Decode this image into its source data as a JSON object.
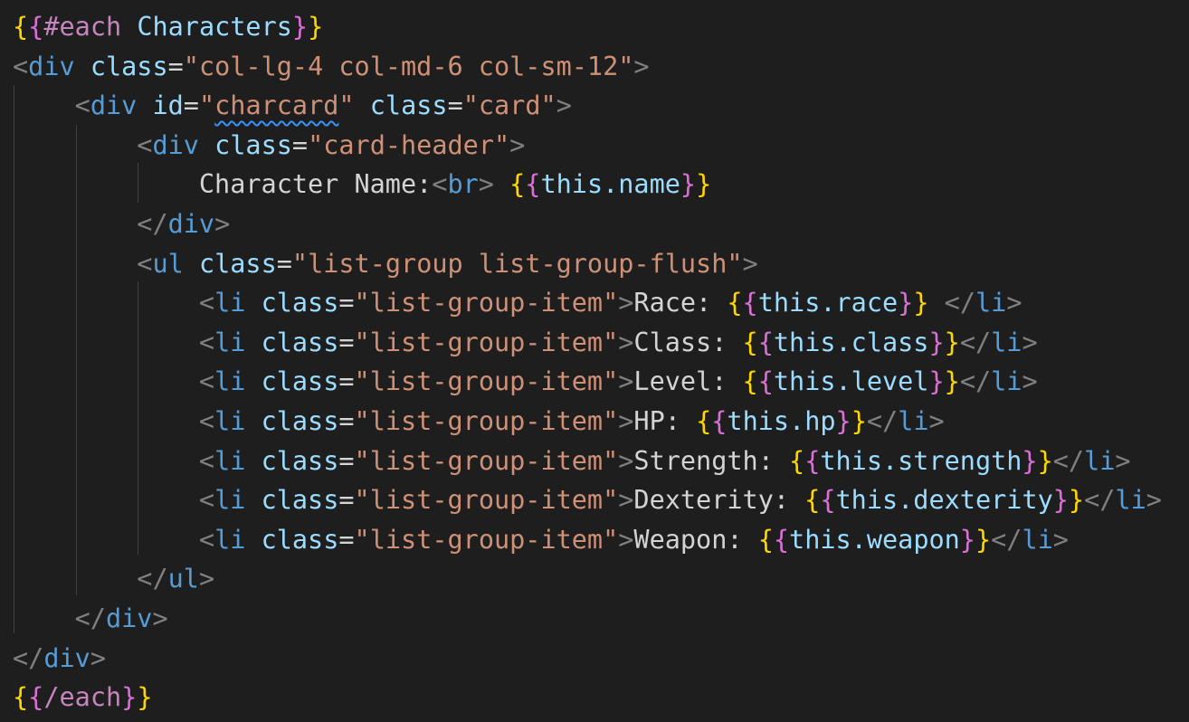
{
  "editor": {
    "language": "handlebars",
    "colors": {
      "background": "#1e1e1e",
      "tag": "#569cd6",
      "attribute": "#9cdcfe",
      "string": "#ce9178",
      "text": "#d4d4d4",
      "punctuation": "#808080",
      "brace_outer": "#ffd700",
      "brace_inner": "#da70d6",
      "helper_keyword": "#c586c0",
      "spell_check_underline": "#3794ff"
    },
    "lines": [
      {
        "tokens": [
          [
            "{",
            "tok-brace-yellow"
          ],
          [
            "{",
            "tok-brace-pink"
          ],
          [
            "#each",
            "tok-hbs-kw"
          ],
          [
            " ",
            "tok-text"
          ],
          [
            "Characters",
            "tok-hbs-var"
          ],
          [
            "}",
            "tok-brace-pink"
          ],
          [
            "}",
            "tok-brace-yellow"
          ]
        ]
      },
      {
        "tokens": [
          [
            "<",
            "tok-punct"
          ],
          [
            "div",
            "tok-tag"
          ],
          [
            " ",
            "tok-text"
          ],
          [
            "class",
            "tok-attr"
          ],
          [
            "=",
            "tok-eq"
          ],
          [
            "\"col-lg-4 col-md-6 col-sm-12\"",
            "tok-str"
          ],
          [
            ">",
            "tok-punct"
          ]
        ]
      },
      {
        "tokens": [
          [
            "    ",
            "tok-text"
          ],
          [
            "<",
            "tok-punct"
          ],
          [
            "div",
            "tok-tag"
          ],
          [
            " ",
            "tok-text"
          ],
          [
            "id",
            "tok-attr"
          ],
          [
            "=",
            "tok-eq"
          ],
          [
            "\"",
            "tok-str"
          ],
          [
            "charcard",
            "tok-str squiggle"
          ],
          [
            "\"",
            "tok-str"
          ],
          [
            " ",
            "tok-text"
          ],
          [
            "class",
            "tok-attr"
          ],
          [
            "=",
            "tok-eq"
          ],
          [
            "\"card\"",
            "tok-str"
          ],
          [
            ">",
            "tok-punct"
          ]
        ]
      },
      {
        "tokens": [
          [
            "        ",
            "tok-text"
          ],
          [
            "<",
            "tok-punct"
          ],
          [
            "div",
            "tok-tag"
          ],
          [
            " ",
            "tok-text"
          ],
          [
            "class",
            "tok-attr"
          ],
          [
            "=",
            "tok-eq"
          ],
          [
            "\"card-header\"",
            "tok-str"
          ],
          [
            ">",
            "tok-punct"
          ]
        ]
      },
      {
        "tokens": [
          [
            "            Character Name:",
            "tok-text"
          ],
          [
            "<",
            "tok-punct"
          ],
          [
            "br",
            "tok-tag"
          ],
          [
            ">",
            "tok-punct"
          ],
          [
            " ",
            "tok-text"
          ],
          [
            "{",
            "tok-brace-yellow"
          ],
          [
            "{",
            "tok-brace-pink"
          ],
          [
            "this.name",
            "tok-hbs-var"
          ],
          [
            "}",
            "tok-brace-pink"
          ],
          [
            "}",
            "tok-brace-yellow"
          ]
        ]
      },
      {
        "tokens": [
          [
            "        ",
            "tok-text"
          ],
          [
            "</",
            "tok-punct"
          ],
          [
            "div",
            "tok-tag"
          ],
          [
            ">",
            "tok-punct"
          ]
        ]
      },
      {
        "tokens": [
          [
            "        ",
            "tok-text"
          ],
          [
            "<",
            "tok-punct"
          ],
          [
            "ul",
            "tok-tag"
          ],
          [
            " ",
            "tok-text"
          ],
          [
            "class",
            "tok-attr"
          ],
          [
            "=",
            "tok-eq"
          ],
          [
            "\"list-group list-group-flush\"",
            "tok-str"
          ],
          [
            ">",
            "tok-punct"
          ]
        ]
      },
      {
        "tokens": [
          [
            "            ",
            "tok-text"
          ],
          [
            "<",
            "tok-punct"
          ],
          [
            "li",
            "tok-tag"
          ],
          [
            " ",
            "tok-text"
          ],
          [
            "class",
            "tok-attr"
          ],
          [
            "=",
            "tok-eq"
          ],
          [
            "\"list-group-item\"",
            "tok-str"
          ],
          [
            ">",
            "tok-punct"
          ],
          [
            "Race: ",
            "tok-text"
          ],
          [
            "{",
            "tok-brace-yellow"
          ],
          [
            "{",
            "tok-brace-pink"
          ],
          [
            "this.race",
            "tok-hbs-var"
          ],
          [
            "}",
            "tok-brace-pink"
          ],
          [
            "}",
            "tok-brace-yellow"
          ],
          [
            " ",
            "tok-text"
          ],
          [
            "</",
            "tok-punct"
          ],
          [
            "li",
            "tok-tag"
          ],
          [
            ">",
            "tok-punct"
          ]
        ]
      },
      {
        "tokens": [
          [
            "            ",
            "tok-text"
          ],
          [
            "<",
            "tok-punct"
          ],
          [
            "li",
            "tok-tag"
          ],
          [
            " ",
            "tok-text"
          ],
          [
            "class",
            "tok-attr"
          ],
          [
            "=",
            "tok-eq"
          ],
          [
            "\"list-group-item\"",
            "tok-str"
          ],
          [
            ">",
            "tok-punct"
          ],
          [
            "Class: ",
            "tok-text"
          ],
          [
            "{",
            "tok-brace-yellow"
          ],
          [
            "{",
            "tok-brace-pink"
          ],
          [
            "this.class",
            "tok-hbs-var"
          ],
          [
            "}",
            "tok-brace-pink"
          ],
          [
            "}",
            "tok-brace-yellow"
          ],
          [
            "</",
            "tok-punct"
          ],
          [
            "li",
            "tok-tag"
          ],
          [
            ">",
            "tok-punct"
          ]
        ]
      },
      {
        "tokens": [
          [
            "            ",
            "tok-text"
          ],
          [
            "<",
            "tok-punct"
          ],
          [
            "li",
            "tok-tag"
          ],
          [
            " ",
            "tok-text"
          ],
          [
            "class",
            "tok-attr"
          ],
          [
            "=",
            "tok-eq"
          ],
          [
            "\"list-group-item\"",
            "tok-str"
          ],
          [
            ">",
            "tok-punct"
          ],
          [
            "Level: ",
            "tok-text"
          ],
          [
            "{",
            "tok-brace-yellow"
          ],
          [
            "{",
            "tok-brace-pink"
          ],
          [
            "this.level",
            "tok-hbs-var"
          ],
          [
            "}",
            "tok-brace-pink"
          ],
          [
            "}",
            "tok-brace-yellow"
          ],
          [
            "</",
            "tok-punct"
          ],
          [
            "li",
            "tok-tag"
          ],
          [
            ">",
            "tok-punct"
          ]
        ]
      },
      {
        "tokens": [
          [
            "            ",
            "tok-text"
          ],
          [
            "<",
            "tok-punct"
          ],
          [
            "li",
            "tok-tag"
          ],
          [
            " ",
            "tok-text"
          ],
          [
            "class",
            "tok-attr"
          ],
          [
            "=",
            "tok-eq"
          ],
          [
            "\"list-group-item\"",
            "tok-str"
          ],
          [
            ">",
            "tok-punct"
          ],
          [
            "HP: ",
            "tok-text"
          ],
          [
            "{",
            "tok-brace-yellow"
          ],
          [
            "{",
            "tok-brace-pink"
          ],
          [
            "this.hp",
            "tok-hbs-var"
          ],
          [
            "}",
            "tok-brace-pink"
          ],
          [
            "}",
            "tok-brace-yellow"
          ],
          [
            "</",
            "tok-punct"
          ],
          [
            "li",
            "tok-tag"
          ],
          [
            ">",
            "tok-punct"
          ]
        ]
      },
      {
        "tokens": [
          [
            "            ",
            "tok-text"
          ],
          [
            "<",
            "tok-punct"
          ],
          [
            "li",
            "tok-tag"
          ],
          [
            " ",
            "tok-text"
          ],
          [
            "class",
            "tok-attr"
          ],
          [
            "=",
            "tok-eq"
          ],
          [
            "\"list-group-item\"",
            "tok-str"
          ],
          [
            ">",
            "tok-punct"
          ],
          [
            "Strength: ",
            "tok-text"
          ],
          [
            "{",
            "tok-brace-yellow"
          ],
          [
            "{",
            "tok-brace-pink"
          ],
          [
            "this.strength",
            "tok-hbs-var"
          ],
          [
            "}",
            "tok-brace-pink"
          ],
          [
            "}",
            "tok-brace-yellow"
          ],
          [
            "</",
            "tok-punct"
          ],
          [
            "li",
            "tok-tag"
          ],
          [
            ">",
            "tok-punct"
          ]
        ]
      },
      {
        "tokens": [
          [
            "            ",
            "tok-text"
          ],
          [
            "<",
            "tok-punct"
          ],
          [
            "li",
            "tok-tag"
          ],
          [
            " ",
            "tok-text"
          ],
          [
            "class",
            "tok-attr"
          ],
          [
            "=",
            "tok-eq"
          ],
          [
            "\"list-group-item\"",
            "tok-str"
          ],
          [
            ">",
            "tok-punct"
          ],
          [
            "Dexterity: ",
            "tok-text"
          ],
          [
            "{",
            "tok-brace-yellow"
          ],
          [
            "{",
            "tok-brace-pink"
          ],
          [
            "this.dexterity",
            "tok-hbs-var"
          ],
          [
            "}",
            "tok-brace-pink"
          ],
          [
            "}",
            "tok-brace-yellow"
          ],
          [
            "</",
            "tok-punct"
          ],
          [
            "li",
            "tok-tag"
          ],
          [
            ">",
            "tok-punct"
          ]
        ]
      },
      {
        "tokens": [
          [
            "            ",
            "tok-text"
          ],
          [
            "<",
            "tok-punct"
          ],
          [
            "li",
            "tok-tag"
          ],
          [
            " ",
            "tok-text"
          ],
          [
            "class",
            "tok-attr"
          ],
          [
            "=",
            "tok-eq"
          ],
          [
            "\"list-group-item\"",
            "tok-str"
          ],
          [
            ">",
            "tok-punct"
          ],
          [
            "Weapon: ",
            "tok-text"
          ],
          [
            "{",
            "tok-brace-yellow"
          ],
          [
            "{",
            "tok-brace-pink"
          ],
          [
            "this.weapon",
            "tok-hbs-var"
          ],
          [
            "}",
            "tok-brace-pink"
          ],
          [
            "}",
            "tok-brace-yellow"
          ],
          [
            "</",
            "tok-punct"
          ],
          [
            "li",
            "tok-tag"
          ],
          [
            ">",
            "tok-punct"
          ]
        ]
      },
      {
        "tokens": [
          [
            "        ",
            "tok-text"
          ],
          [
            "</",
            "tok-punct"
          ],
          [
            "ul",
            "tok-tag"
          ],
          [
            ">",
            "tok-punct"
          ]
        ]
      },
      {
        "tokens": [
          [
            "    ",
            "tok-text"
          ],
          [
            "</",
            "tok-punct"
          ],
          [
            "div",
            "tok-tag"
          ],
          [
            ">",
            "tok-punct"
          ]
        ]
      },
      {
        "tokens": [
          [
            "</",
            "tok-punct"
          ],
          [
            "div",
            "tok-tag"
          ],
          [
            ">",
            "tok-punct"
          ]
        ]
      },
      {
        "tokens": [
          [
            "{",
            "tok-brace-yellow"
          ],
          [
            "{",
            "tok-brace-pink"
          ],
          [
            "/each",
            "tok-hbs-kw"
          ],
          [
            "}",
            "tok-brace-pink"
          ],
          [
            "}",
            "tok-brace-yellow"
          ]
        ]
      }
    ]
  }
}
